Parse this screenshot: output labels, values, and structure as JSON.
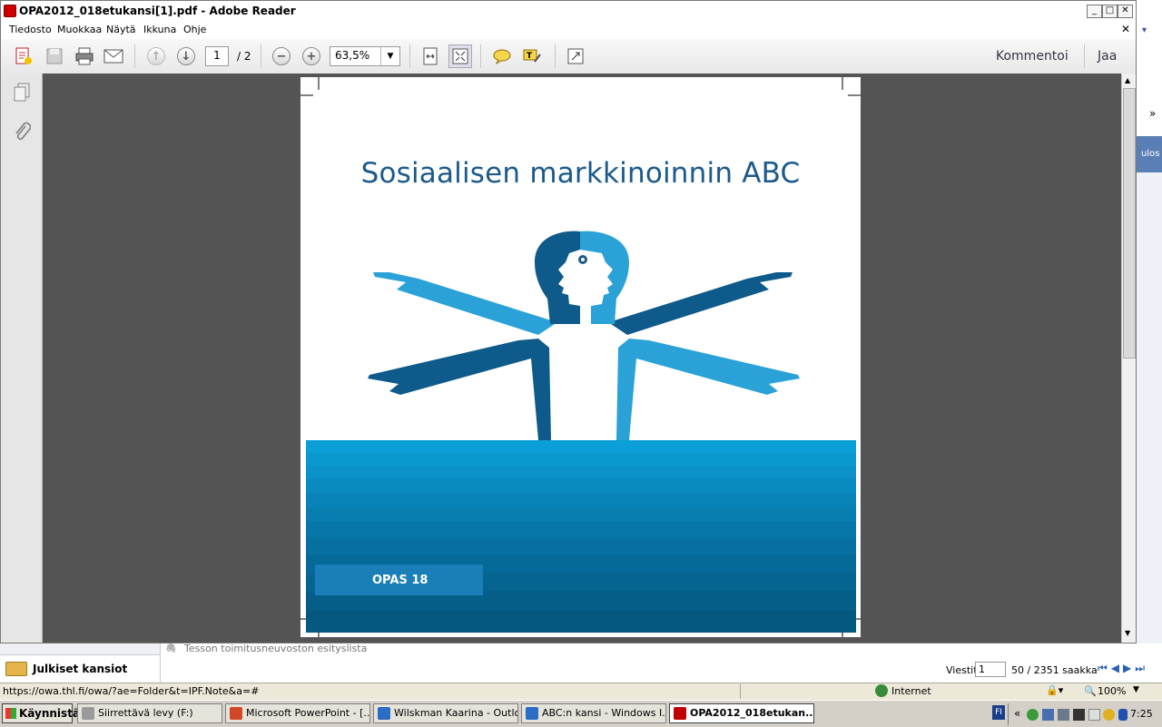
{
  "window": {
    "title": "OPA2012_018etukansi[1].pdf - Adobe Reader",
    "min": "_",
    "max": "□",
    "close": "✕",
    "doc_close": "✕"
  },
  "menu": [
    "Tiedosto",
    "Muokkaa",
    "Näytä",
    "Ikkuna",
    "Ohje"
  ],
  "toolbar": {
    "page_current": "1",
    "page_total": "/ 2",
    "zoom": "63,5%",
    "comment_label": "Kommentoi",
    "share_label": "Jaa"
  },
  "pdf": {
    "title": "Sosiaalisen markkinoinnin ABC",
    "badge": "OPAS  18"
  },
  "outlook": {
    "partial_message": "Tesson toimitusneuvoston esityslista",
    "public_folders": "Julkiset kansiot",
    "messages_label": "Viestit",
    "messages_value": "1",
    "range_text": "50 / 2351 saakka",
    "right_logout": "ulos",
    "right_chevron": "»"
  },
  "statusbar": {
    "url": "https://owa.thl.fi/owa/?ae=Folder&t=IPF.Note&a=#",
    "zone": "Internet",
    "zoom": "100%"
  },
  "taskbar": {
    "start": "Käynnistä",
    "tasks": [
      {
        "label": "Siirrettävä levy (F:)",
        "color": "#9a9a9a"
      },
      {
        "label": "Microsoft PowerPoint - [...",
        "color": "#d24726"
      },
      {
        "label": "Wilskman Kaarina - Outlo...",
        "color": "#2b6cc4"
      },
      {
        "label": "ABC:n kansi - Windows I...",
        "color": "#2b6cc4"
      },
      {
        "label": "OPA2012_018etukan...",
        "color": "#c00000"
      }
    ],
    "lang": "FI",
    "tray_chevron": "«",
    "clock": "7:25"
  },
  "colors": {
    "title_blue": "#1c5a8a",
    "dark_blue": "#0e5a8a",
    "light_blue": "#2aa2d8"
  }
}
